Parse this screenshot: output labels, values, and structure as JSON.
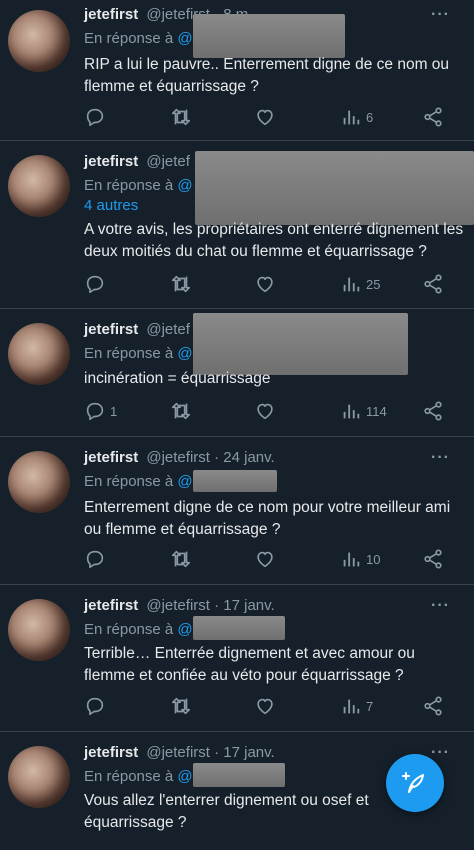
{
  "tweets": [
    {
      "name": "jetefirst",
      "handle": "@jetefirst",
      "time": "· 8 m",
      "reply_prefix": "En réponse à",
      "mention": "@",
      "extra": "",
      "text": "RIP a lui le pauvre.. Enterrement digne de ce nom ou flemme et équarrissage ?",
      "reply_count": "",
      "views": "6"
    },
    {
      "name": "jetefirst",
      "handle": "@jetef",
      "time": "",
      "reply_prefix": "En réponse à",
      "mention": "@",
      "extra": "4 autres",
      "text": "A votre avis, les propriétaires ont enterré dignement les deux moitiés du chat ou flemme et équarrissage ?",
      "reply_count": "",
      "views": "25"
    },
    {
      "name": "jetefirst",
      "handle": "@jetef",
      "time": "",
      "reply_prefix": "En réponse à",
      "mention": "@",
      "extra": "",
      "text": "incinération = équarrissage",
      "reply_count": "1",
      "views": "114"
    },
    {
      "name": "jetefirst",
      "handle": "@jetefirst",
      "time": "· 24 janv.",
      "reply_prefix": "En réponse à",
      "mention": "@",
      "extra": "",
      "text": "Enterrement digne de ce nom pour votre meilleur ami ou flemme et équarrissage ?",
      "reply_count": "",
      "views": "10"
    },
    {
      "name": "jetefirst",
      "handle": "@jetefirst",
      "time": "· 17 janv.",
      "reply_prefix": "En réponse à",
      "mention": "@",
      "extra": "",
      "text": "Terrible… Enterrée dignement et avec amour ou flemme et confiée au véto pour équarrissage ?",
      "reply_count": "",
      "views": "7"
    },
    {
      "name": "jetefirst",
      "handle": "@jetefirst",
      "time": "· 17 janv.",
      "reply_prefix": "En réponse à",
      "mention": "@",
      "extra": "",
      "text": "Vous allez l'enterrer dignement ou osef et équarrissage ?",
      "reply_count": "",
      "views": ""
    }
  ],
  "icons": {
    "reply": "reply-icon",
    "retweet": "retweet-icon",
    "like": "like-icon",
    "views": "views-icon",
    "share": "share-icon",
    "compose": "compose-tweet-icon"
  },
  "colors": {
    "background": "#15202b",
    "accent": "#1d9bf0",
    "muted": "#8b98a5"
  }
}
